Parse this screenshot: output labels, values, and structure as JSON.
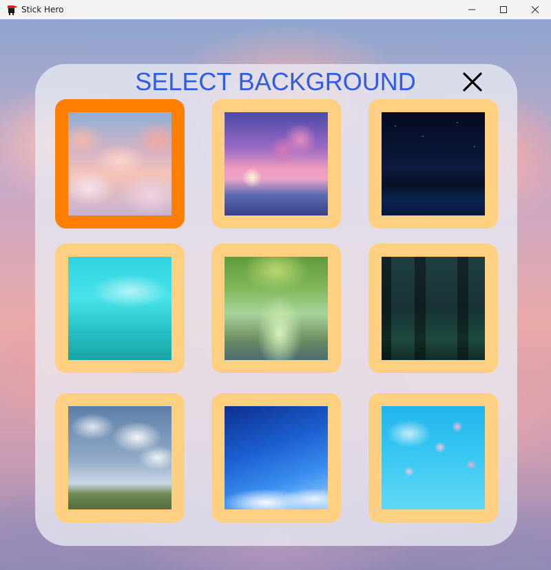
{
  "window": {
    "title": "Stick Hero",
    "controls": {
      "minimize": "—",
      "maximize": "☐",
      "close": "✕"
    }
  },
  "dialog": {
    "title": "SELECT BACKGROUND",
    "close_icon": "close-icon"
  },
  "backgrounds": [
    {
      "name": "pink-clouds",
      "selected": true
    },
    {
      "name": "sakura-sea",
      "selected": false
    },
    {
      "name": "starry-night",
      "selected": false
    },
    {
      "name": "teal-willow",
      "selected": false
    },
    {
      "name": "forest-path",
      "selected": false
    },
    {
      "name": "dark-forest",
      "selected": false
    },
    {
      "name": "sky-field",
      "selected": false
    },
    {
      "name": "blue-sky-streaks",
      "selected": false
    },
    {
      "name": "cherry-blossom",
      "selected": false
    }
  ],
  "colors": {
    "title_blue": "#2f5be6",
    "tile_default": "#ffd082",
    "tile_selected": "#ff7f00",
    "panel": "#e8eaf3"
  }
}
